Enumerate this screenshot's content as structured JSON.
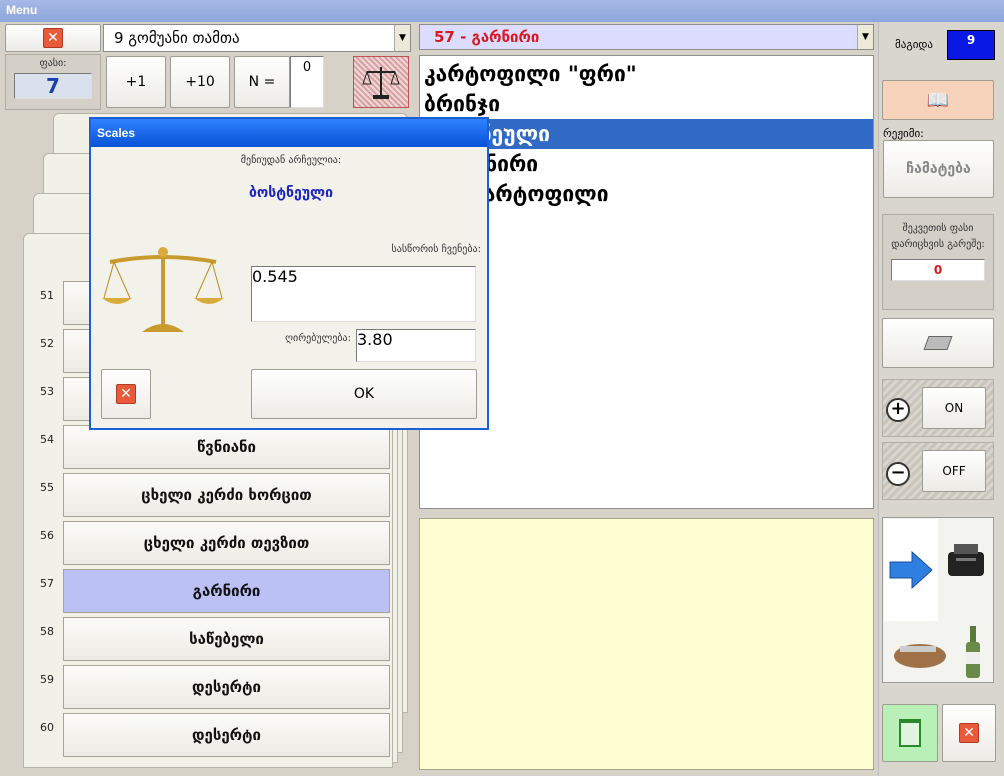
{
  "window": {
    "title": "Menu"
  },
  "top": {
    "close_icon": "close-icon",
    "table_combo": "9  გომუანი თამთა",
    "price_label": "ფასი:",
    "price_value": "7",
    "plus1": "+1",
    "plus10": "+10",
    "n_label": "N =",
    "n_value": "0",
    "scales_icon": "scales-icon"
  },
  "categories": [
    {
      "num": "51",
      "label": ""
    },
    {
      "num": "52",
      "label": ""
    },
    {
      "num": "53",
      "label": ""
    },
    {
      "num": "54",
      "label": "წვნიანი"
    },
    {
      "num": "55",
      "label": "ცხელი კერძი ხორცით"
    },
    {
      "num": "56",
      "label": "ცხელი კერძი თევზით"
    },
    {
      "num": "57",
      "label": "გარნირი"
    },
    {
      "num": "58",
      "label": "საწებელი"
    },
    {
      "num": "59",
      "label": "დესერტი"
    },
    {
      "num": "60",
      "label": "დესერტი"
    }
  ],
  "items_combo": "57 - გარნირი",
  "items": [
    "კარტოფილი \"ფრი\"",
    "ბრინჯი",
    "ბოსტნეული",
    "ს გარნირი",
    "არი კარტოფილი"
  ],
  "right": {
    "table_label": "მაგიდა",
    "table_value": "9",
    "mode_label": "რეჟიმი:",
    "mode_value": "ჩამატება",
    "weight_label": "შეკვეთის ფასი დარიცხვის გარეშე:",
    "weight_value": "0",
    "on_label": "ON",
    "off_label": "OFF"
  },
  "dialog": {
    "title": "Scales",
    "chosen_label": "მენიუდან არჩეულია:",
    "chosen_value": "ბოსტნეული",
    "scale_label": "სასწორის ჩვენება:",
    "scale_value": "0.545",
    "price_label": "ღირებულება:",
    "price_value": "3.80",
    "ok": "OK"
  },
  "colors": {
    "accent": "#316ac5",
    "price_red": "#d71920",
    "table_blue": "#0a18e6",
    "note_bg": "#fefed2"
  }
}
